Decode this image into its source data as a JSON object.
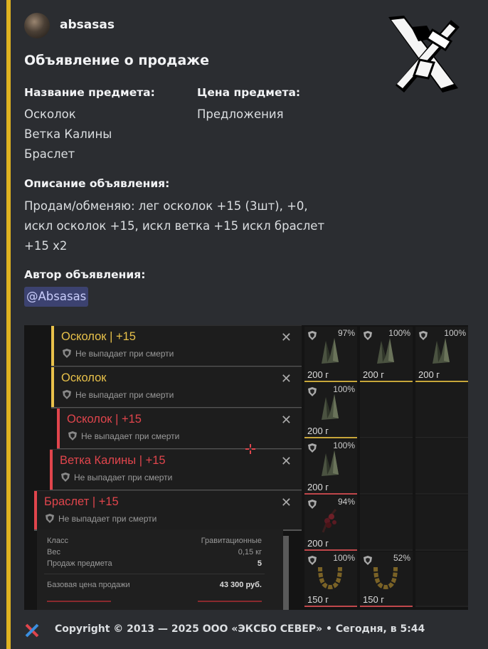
{
  "embed": {
    "accent_color": "#e0b321",
    "author": {
      "name": "absasas",
      "avatar": "avatar-icon"
    },
    "thumbnail": "exbo-x-logo-icon",
    "title": "Объявление о продаже",
    "fields": {
      "item_name_label": "Название предмета:",
      "item_names": [
        "Осколок",
        "Ветка Калины",
        "Браслет"
      ],
      "price_label": "Цена предмета:",
      "price_value": "Предложения",
      "description_label": "Описание объявления:",
      "description_lines": [
        "Продам/обменяю: лег осколок +15 (3шт), +0,",
        "искл осколок +15, искл ветка +15 искл браслет",
        "+15 x2"
      ],
      "author_label": "Автор объявления:",
      "author_mention": "@Absasas"
    },
    "footer": {
      "icon": "exbo-x-small-icon",
      "text": "Copyright © 2013 — 2025 ООО «ЭКСБО СЕВЕР» • Сегодня, в 5:44"
    }
  },
  "screenshot": {
    "cards": [
      {
        "name": "Осколок | +15",
        "subtitle": "Не выпадает при смерти",
        "color": "#e8c14a"
      },
      {
        "name": "Осколок",
        "subtitle": "Не выпадает при смерти",
        "color": "#e8c14a"
      },
      {
        "name": "Осколок | +15",
        "subtitle": "Не выпадает при смерти",
        "color": "#e0454c"
      },
      {
        "name": "Ветка Калины | +15",
        "subtitle": "Не выпадает при смерти",
        "color": "#e0454c"
      },
      {
        "name": "Браслет | +15",
        "subtitle": "Не выпадает при смерти",
        "color": "#e0454c"
      }
    ],
    "stats": {
      "class_label": "Класс",
      "class_value": "Гравитационные",
      "weight_label": "Вес",
      "weight_value": "0,15 кг",
      "sell_label": "Продаж предмета",
      "sell_value": "5",
      "base_price_label": "Базовая цена продажи",
      "base_price_value": "43 300 руб."
    },
    "slots": [
      {
        "pct": "97%",
        "price": "200 г"
      },
      {
        "pct": "100%",
        "price": "200 г"
      },
      {
        "pct": "100%",
        "price": "200 г"
      },
      {
        "pct": "100%",
        "price": "200 г"
      },
      {
        "pct": "100%",
        "price": "200 г"
      },
      {
        "pct": "94%",
        "price": "200 г"
      },
      {
        "pct": "100%",
        "price": "150 г"
      },
      {
        "pct": "52%",
        "price": "150 г"
      }
    ]
  }
}
